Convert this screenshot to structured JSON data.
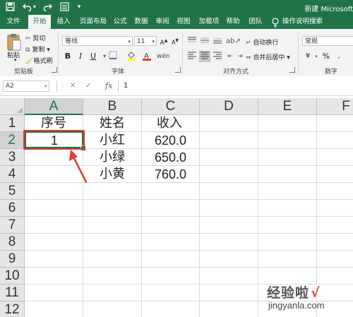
{
  "window": {
    "title": "新建 Microsoft"
  },
  "colors": {
    "accent": "#217346",
    "annotation": "#e03a2f"
  },
  "quick_access": {
    "icons": [
      "save-icon",
      "undo-icon",
      "redo-icon",
      "form-icon",
      "customize-icon"
    ]
  },
  "ribbon_tabs": [
    {
      "label": "文件",
      "active": false
    },
    {
      "label": "开始",
      "active": true
    },
    {
      "label": "插入",
      "active": false
    },
    {
      "label": "页面布局",
      "active": false
    },
    {
      "label": "公式",
      "active": false
    },
    {
      "label": "数据",
      "active": false
    },
    {
      "label": "审阅",
      "active": false
    },
    {
      "label": "视图",
      "active": false
    },
    {
      "label": "加载项",
      "active": false
    },
    {
      "label": "帮助",
      "active": false
    },
    {
      "label": "团队",
      "active": false
    }
  ],
  "tell_me": "操作说明搜索",
  "ribbon": {
    "clipboard": {
      "paste": "粘贴",
      "cut": "剪切",
      "copy": "复制",
      "format_painter": "格式刷",
      "group": "剪贴板"
    },
    "font": {
      "name": "等线",
      "size": "11",
      "group": "字体",
      "bold": "B",
      "italic": "I",
      "underline": "U"
    },
    "alignment": {
      "wrap": "自动换行",
      "merge": "合并后居中",
      "group": "对齐方式"
    },
    "number": {
      "format": "常规",
      "group": "数字",
      "percent": "%"
    }
  },
  "formula_bar": {
    "name_box": "A2",
    "value": "1",
    "fx": "fx"
  },
  "sheet": {
    "columns": [
      "A",
      "B",
      "C",
      "D",
      "E",
      "F"
    ],
    "selected_column": "A",
    "rows": [
      "1",
      "2",
      "3",
      "4",
      "5",
      "6",
      "7",
      "8",
      "9",
      "10",
      "11",
      "12"
    ],
    "selected_row": "2",
    "cells": {
      "A1": "序号",
      "B1": "姓名",
      "C1": "收入",
      "A2": "1",
      "B2": "小红",
      "C2": "620.0",
      "B3": "小绿",
      "C3": "650.0",
      "B4": "小黄",
      "C4": "760.0"
    },
    "active_cell": "A2"
  },
  "watermark": {
    "main": "经验啦",
    "check": "√",
    "sub": "jingyanla.com"
  }
}
